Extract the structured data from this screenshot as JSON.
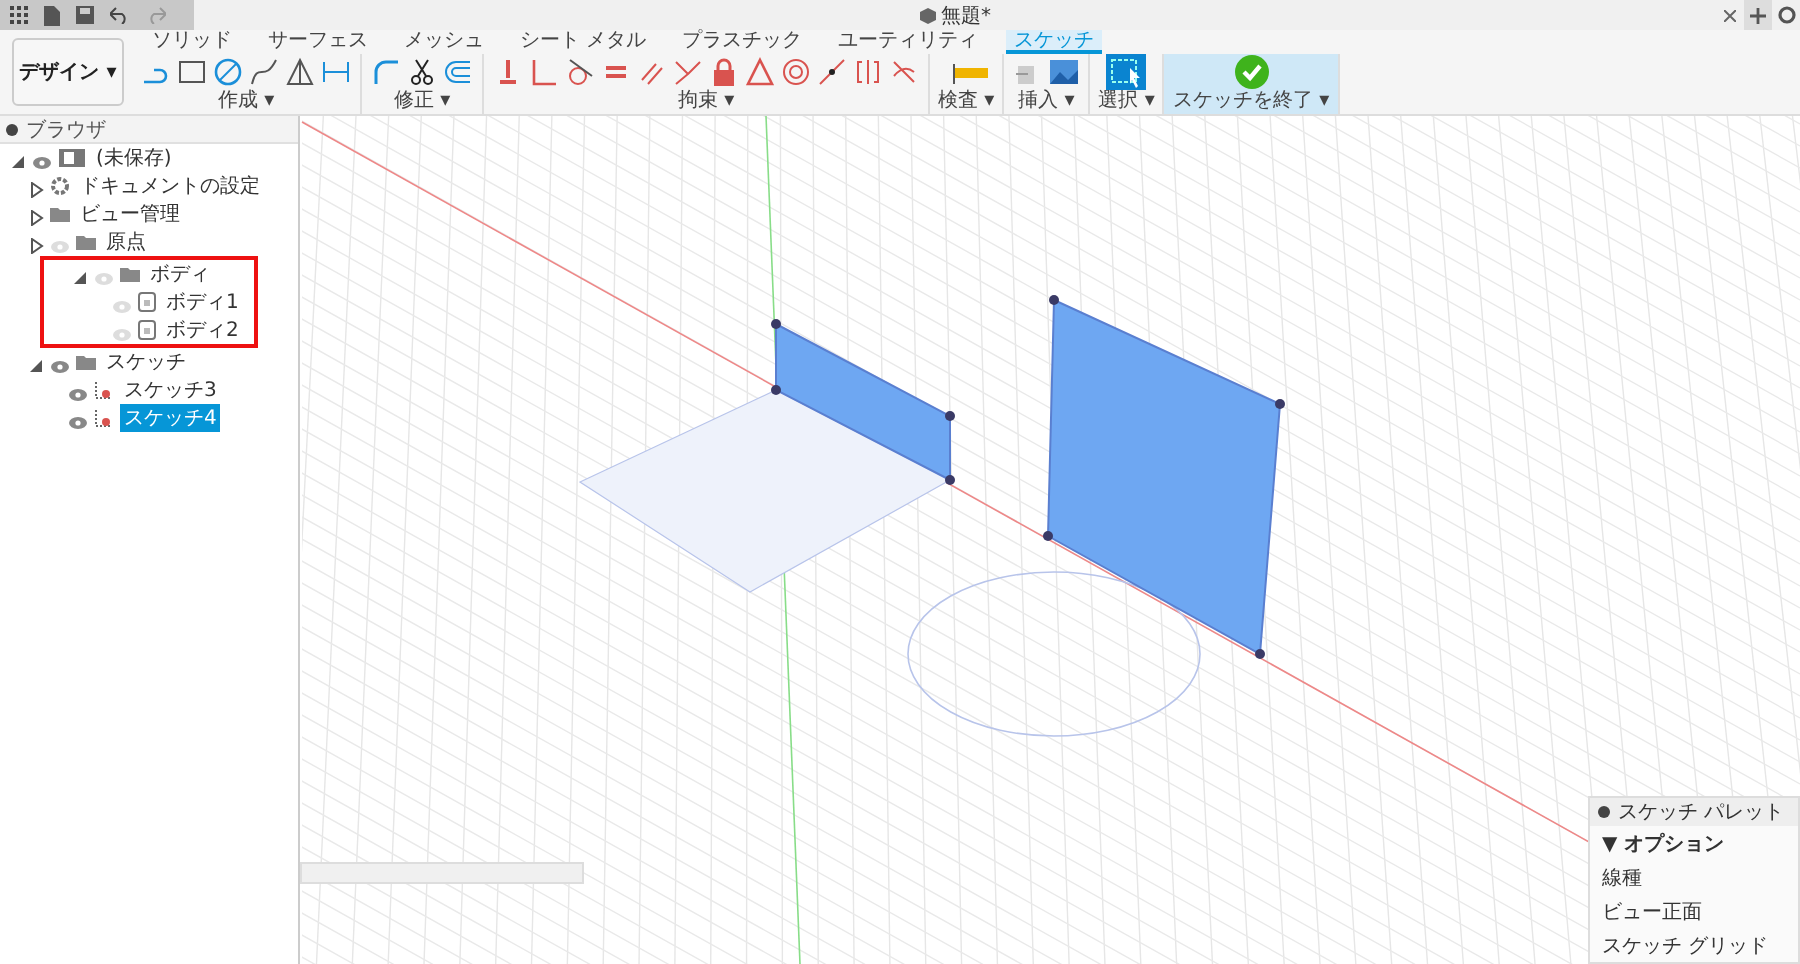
{
  "document_tab": {
    "title": "無題*"
  },
  "workspace_button": {
    "label": "デザイン ▾"
  },
  "ribbon_tabs": [
    {
      "label": "ソリッド",
      "selected": false
    },
    {
      "label": "サーフェス",
      "selected": false
    },
    {
      "label": "メッシュ",
      "selected": false
    },
    {
      "label": "シート メタル",
      "selected": false
    },
    {
      "label": "プラスチック",
      "selected": false
    },
    {
      "label": "ユーティリティ",
      "selected": false
    },
    {
      "label": "スケッチ",
      "selected": true
    }
  ],
  "tool_groups": [
    {
      "label": "作成 ▾",
      "kind": "create"
    },
    {
      "label": "修正 ▾",
      "kind": "modify"
    },
    {
      "label": "拘束 ▾",
      "kind": "constrain"
    },
    {
      "label": "検査 ▾",
      "kind": "inspect"
    },
    {
      "label": "挿入 ▾",
      "kind": "insert"
    },
    {
      "label": "選択 ▾",
      "kind": "select"
    },
    {
      "label": "スケッチを終了 ▾",
      "kind": "finish"
    }
  ],
  "browser": {
    "title": "ブラウザ",
    "items": [
      {
        "label": "(未保存)",
        "kind": "component",
        "expanded": true,
        "visible": true,
        "highlighted": false,
        "selected": false,
        "children": [
          {
            "label": "ドキュメントの設定",
            "kind": "settings",
            "expanded": false,
            "highlighted": false,
            "selected": false
          },
          {
            "label": "ビュー管理",
            "kind": "folder",
            "expanded": false,
            "highlighted": false,
            "selected": false
          },
          {
            "label": "原点",
            "kind": "folder",
            "expanded": false,
            "visible": false,
            "highlighted": false,
            "selected": false
          },
          {
            "label": "ボディ",
            "kind": "folder",
            "expanded": true,
            "visible": false,
            "highlighted": true,
            "selected": false,
            "children": [
              {
                "label": "ボディ1",
                "kind": "body",
                "visible": false,
                "highlighted": false,
                "selected": false
              },
              {
                "label": "ボディ2",
                "kind": "body",
                "visible": false,
                "highlighted": false,
                "selected": false
              }
            ]
          },
          {
            "label": "スケッチ",
            "kind": "folder",
            "expanded": true,
            "visible": true,
            "highlighted": false,
            "selected": false,
            "children": [
              {
                "label": "スケッチ3",
                "kind": "sketch",
                "visible": true,
                "highlighted": false,
                "selected": false
              },
              {
                "label": "スケッチ4",
                "kind": "sketch",
                "visible": true,
                "highlighted": false,
                "selected": true
              }
            ]
          }
        ]
      }
    ]
  },
  "sketch_palette": {
    "title": "スケッチ パレット",
    "section": "▼ オプション",
    "options": [
      "線種",
      "ビュー正面",
      "スケッチ グリッド"
    ]
  }
}
